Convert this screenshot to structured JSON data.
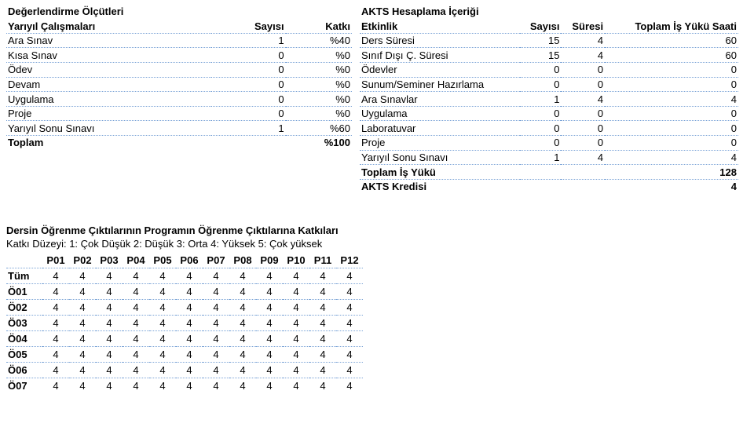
{
  "eval": {
    "title": "Değerlendirme Ölçütleri",
    "col_activities": "Yarıyıl Çalışmaları",
    "col_count": "Sayısı",
    "col_weight": "Katkı",
    "rows": [
      {
        "label": "Ara Sınav",
        "count": "1",
        "weight": "%40"
      },
      {
        "label": "Kısa Sınav",
        "count": "0",
        "weight": "%0"
      },
      {
        "label": "Ödev",
        "count": "0",
        "weight": "%0"
      },
      {
        "label": "Devam",
        "count": "0",
        "weight": "%0"
      },
      {
        "label": "Uygulama",
        "count": "0",
        "weight": "%0"
      },
      {
        "label": "Proje",
        "count": "0",
        "weight": "%0"
      },
      {
        "label": "Yarıyıl Sonu Sınavı",
        "count": "1",
        "weight": "%60"
      }
    ],
    "total_label": "Toplam",
    "total_value": "%100"
  },
  "workload": {
    "title": "AKTS Hesaplama İçeriği",
    "col_activity": "Etkinlik",
    "col_count": "Sayısı",
    "col_duration": "Süresi",
    "col_total": "Toplam İş Yükü Saati",
    "rows": [
      {
        "label": "Ders Süresi",
        "count": "15",
        "dur": "4",
        "tot": "60"
      },
      {
        "label": "Sınıf Dışı Ç. Süresi",
        "count": "15",
        "dur": "4",
        "tot": "60"
      },
      {
        "label": "Ödevler",
        "count": "0",
        "dur": "0",
        "tot": "0"
      },
      {
        "label": "Sunum/Seminer Hazırlama",
        "count": "0",
        "dur": "0",
        "tot": "0"
      },
      {
        "label": "Ara Sınavlar",
        "count": "1",
        "dur": "4",
        "tot": "4"
      },
      {
        "label": "Uygulama",
        "count": "0",
        "dur": "0",
        "tot": "0"
      },
      {
        "label": "Laboratuvar",
        "count": "0",
        "dur": "0",
        "tot": "0"
      },
      {
        "label": "Proje",
        "count": "0",
        "dur": "0",
        "tot": "0"
      },
      {
        "label": "Yarıyıl Sonu Sınavı",
        "count": "1",
        "dur": "4",
        "tot": "4"
      }
    ],
    "total_workload_label": "Toplam İş Yükü",
    "total_workload_value": "128",
    "akts_label": "AKTS Kredisi",
    "akts_value": "4"
  },
  "contrib": {
    "title": "Dersin Öğrenme Çıktılarının Programın Öğrenme Çıktılarına Katkıları",
    "legend": "Katkı Düzeyi: 1: Çok Düşük 2: Düşük 3: Orta 4: Yüksek 5: Çok yüksek",
    "headers": [
      "P01",
      "P02",
      "P03",
      "P04",
      "P05",
      "P06",
      "P07",
      "P08",
      "P09",
      "P10",
      "P11",
      "P12"
    ],
    "rows": [
      {
        "label": "Tüm",
        "v": [
          "4",
          "4",
          "4",
          "4",
          "4",
          "4",
          "4",
          "4",
          "4",
          "4",
          "4",
          "4"
        ]
      },
      {
        "label": "Ö01",
        "v": [
          "4",
          "4",
          "4",
          "4",
          "4",
          "4",
          "4",
          "4",
          "4",
          "4",
          "4",
          "4"
        ]
      },
      {
        "label": "Ö02",
        "v": [
          "4",
          "4",
          "4",
          "4",
          "4",
          "4",
          "4",
          "4",
          "4",
          "4",
          "4",
          "4"
        ]
      },
      {
        "label": "Ö03",
        "v": [
          "4",
          "4",
          "4",
          "4",
          "4",
          "4",
          "4",
          "4",
          "4",
          "4",
          "4",
          "4"
        ]
      },
      {
        "label": "Ö04",
        "v": [
          "4",
          "4",
          "4",
          "4",
          "4",
          "4",
          "4",
          "4",
          "4",
          "4",
          "4",
          "4"
        ]
      },
      {
        "label": "Ö05",
        "v": [
          "4",
          "4",
          "4",
          "4",
          "4",
          "4",
          "4",
          "4",
          "4",
          "4",
          "4",
          "4"
        ]
      },
      {
        "label": "Ö06",
        "v": [
          "4",
          "4",
          "4",
          "4",
          "4",
          "4",
          "4",
          "4",
          "4",
          "4",
          "4",
          "4"
        ]
      },
      {
        "label": "Ö07",
        "v": [
          "4",
          "4",
          "4",
          "4",
          "4",
          "4",
          "4",
          "4",
          "4",
          "4",
          "4",
          "4"
        ]
      }
    ]
  }
}
